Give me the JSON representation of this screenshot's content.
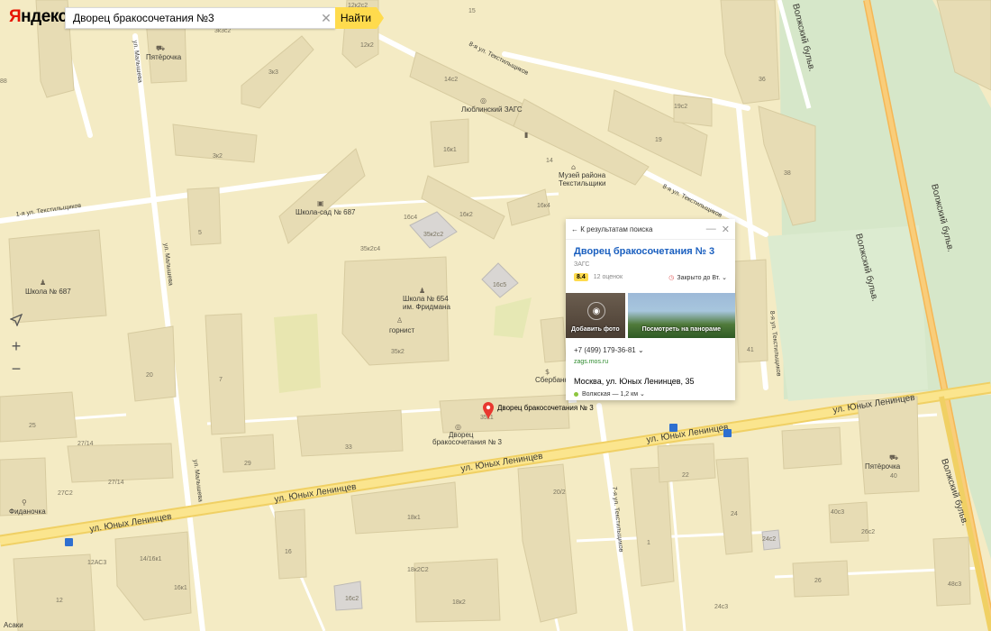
{
  "header": {
    "logo_first": "Я",
    "logo_rest": "ндекс",
    "search_value": "Дворец бракосочетания №3",
    "find_label": "Найти"
  },
  "controls": {
    "locate_icon": "navigation-arrow",
    "zoom_in": "+",
    "zoom_out": "−"
  },
  "card": {
    "back_label": "К результатам поиска",
    "title": "Дворец бракосочетания № 3",
    "category": "ЗАГС",
    "rating": "8.4",
    "reviews": "12 оценок",
    "hours": "Закрыто до Вт.",
    "add_photo": "Добавить фото",
    "panorama": "Посмотреть на панораме",
    "phone": "+7 (499) 179-36-81",
    "site": "zags.mos.ru",
    "address": "Москва, ул. Юных Ленинцев, 35",
    "metro": "Волжская — 1,2 км",
    "metro_color": "#8dc63f"
  },
  "pin": {
    "label": "Дворец бракосочетания № 3",
    "sub": "35к1"
  },
  "map": {
    "streets": {
      "yunykh1": "ул. Юных Ленинцев",
      "yunykh2": "ул. Юных Ленинцев",
      "yunykh3": "ул. Юных Ленинцев",
      "yunykh4": "ул. Юных Ленинцев",
      "yunykh5": "ул. Юных Ленинцев",
      "malyshev1": "ул. Малышева",
      "malyshev2": "ул. Малышева",
      "malyshev3": "ул. Малышева",
      "textil8": "8-я ул. Текстильщиков",
      "textil8b": "8-я ул. Текстильщиков",
      "textil1": "1-я ул. Текстильщиков",
      "textil7": "7-я ул. Текстильщиков",
      "textil8v": "8-я ул. Текстильщиков",
      "volzh1": "Волжский бульв.",
      "volzh2": "Волжский бульв.",
      "volzh3": "Волжский бульв.",
      "volzh4": "Волжский бульв."
    },
    "pois": {
      "pyat1": "Пятёрочка",
      "pyat2": "Пятёрочка",
      "zags1": "Люблинский ЗАГС",
      "museum1": "Музей района",
      "museum2": "Текстильщики",
      "kinder": "Школа-сад № 687",
      "school687": "Школа № 687",
      "school654a": "Школа № 654",
      "school654b": "им. Фридмана",
      "gornist": "горнист",
      "sber": "Сбербанк",
      "dvorec1": "Дворец",
      "dvorec2": "бракосочетания № 3",
      "fidan": "Фиданочка",
      "asaki": "Асаки"
    },
    "buildings": [
      "12к2с2",
      "3к3",
      "3к3с2",
      "5",
      "12к2",
      "14с2",
      "16к1",
      "19с2",
      "19",
      "36",
      "38",
      "14",
      "3к2",
      "16к2",
      "16к4",
      "16с4",
      "35к2с2",
      "35к2с4",
      "16с5",
      "5",
      "20",
      "7",
      "35к2",
      "27/14",
      "27С2",
      "27/14",
      "25",
      "33",
      "29",
      "35к1",
      "20/2",
      "22",
      "24",
      "1",
      "16",
      "18к1",
      "14/16к1",
      "12АС3",
      "16к1",
      "12",
      "16с2",
      "18к2",
      "18к2С2",
      "26",
      "26с2",
      "40с3",
      "24с3",
      "24с2",
      "40",
      "48с3",
      "41",
      "88"
    ]
  }
}
